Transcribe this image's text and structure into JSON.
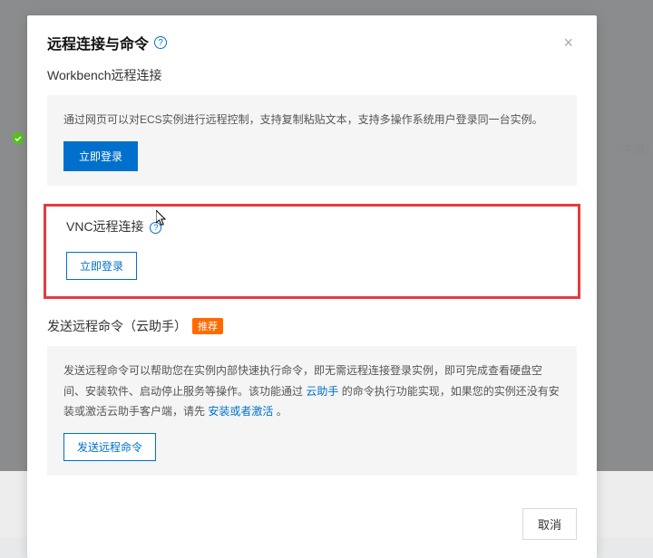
{
  "modal": {
    "title": "远程连接与命令",
    "close": "×"
  },
  "workbench": {
    "title": "Workbench远程连接",
    "description": "通过网页可以对ECS实例进行远程控制，支持复制粘贴文本，支持多操作系统用户登录同一台实例。",
    "button": "立即登录"
  },
  "vnc": {
    "title": "VNC远程连接",
    "button": "立即登录"
  },
  "remote_cmd": {
    "title": "发送远程命令（云助手）",
    "badge": "推荐",
    "desc_part1": "发送远程命令可以帮助您在实例内部快速执行命令，即无需远程连接登录实例，即可完成查看硬盘空间、安装软件、启动停止服务等操作。该功能通过 ",
    "link1": "云助手",
    "desc_part2": " 的命令执行功能实现，如果您的实例还没有安装或激活云助手客户端，请先 ",
    "link2": "安装或者激活",
    "desc_part3": " 。",
    "button": "发送远程命令"
  },
  "footer": {
    "cancel": "取消"
  },
  "background": {
    "text_fragment": "牛值)"
  }
}
